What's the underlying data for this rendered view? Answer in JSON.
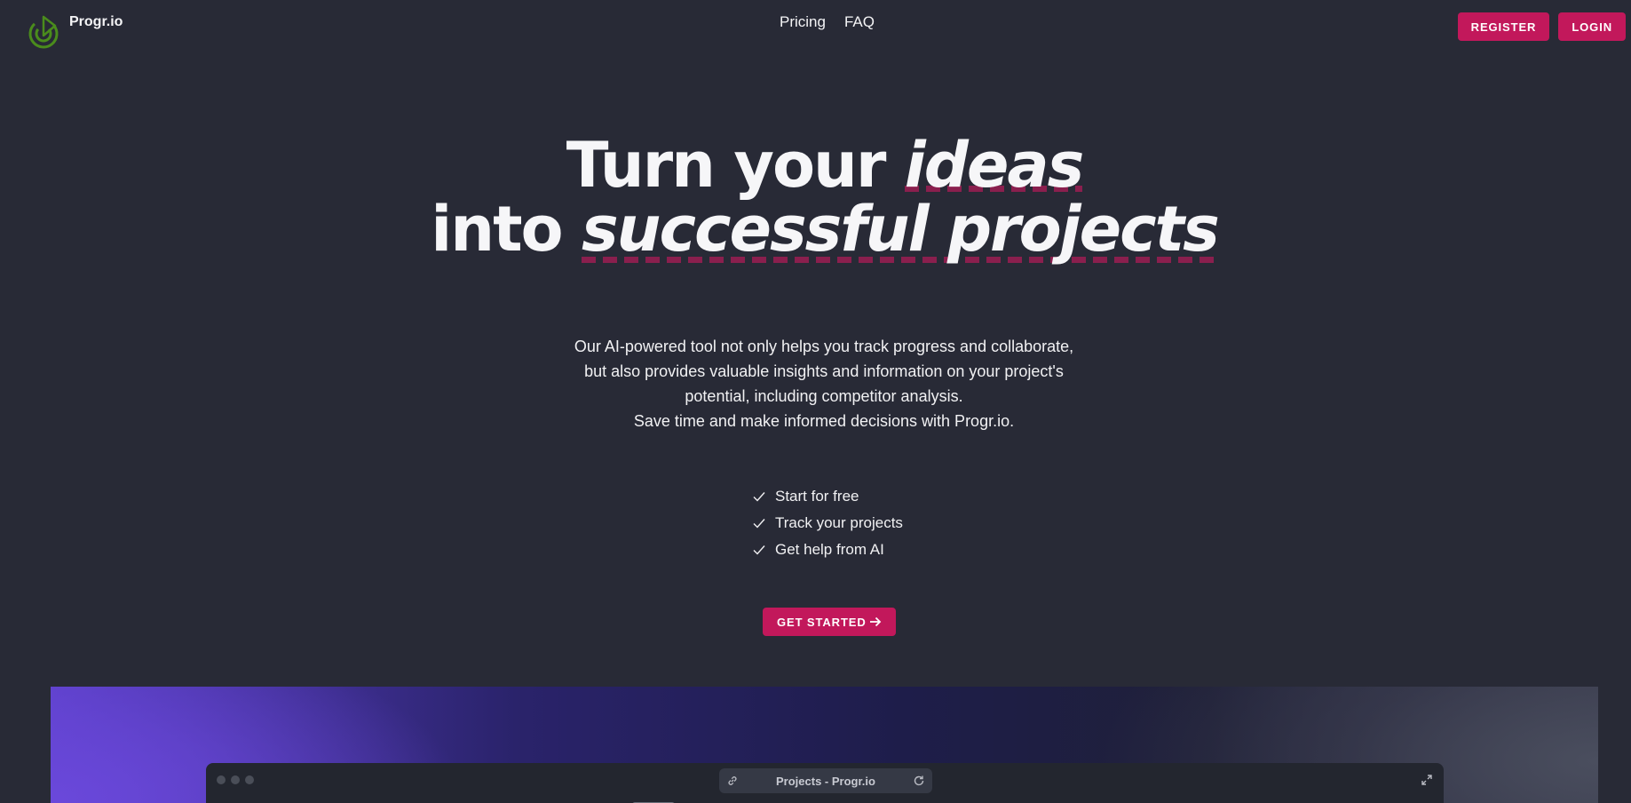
{
  "brand": {
    "name": "Progr.io",
    "accent": "#c2185b",
    "logo_color": "#4a8c1c"
  },
  "nav": {
    "items": [
      "Pricing",
      "FAQ"
    ]
  },
  "auth": {
    "register_label": "REGISTER",
    "login_label": "LOGIN"
  },
  "hero": {
    "title_line1_plain": "Turn your ",
    "title_line1_em": "ideas",
    "title_line2_plain": "into ",
    "title_line2_em": "successful projects",
    "description": [
      "Our AI-powered tool not only helps you track progress and collaborate,",
      "but also provides valuable insights and information on your project's",
      "potential, including competitor analysis.",
      "Save time and make informed decisions with Progr.io."
    ],
    "features": [
      "Start for free",
      "Track your projects",
      "Get help from AI"
    ],
    "cta_label": "GET STARTED"
  },
  "preview": {
    "url_title": "Projects - Progr.io"
  }
}
